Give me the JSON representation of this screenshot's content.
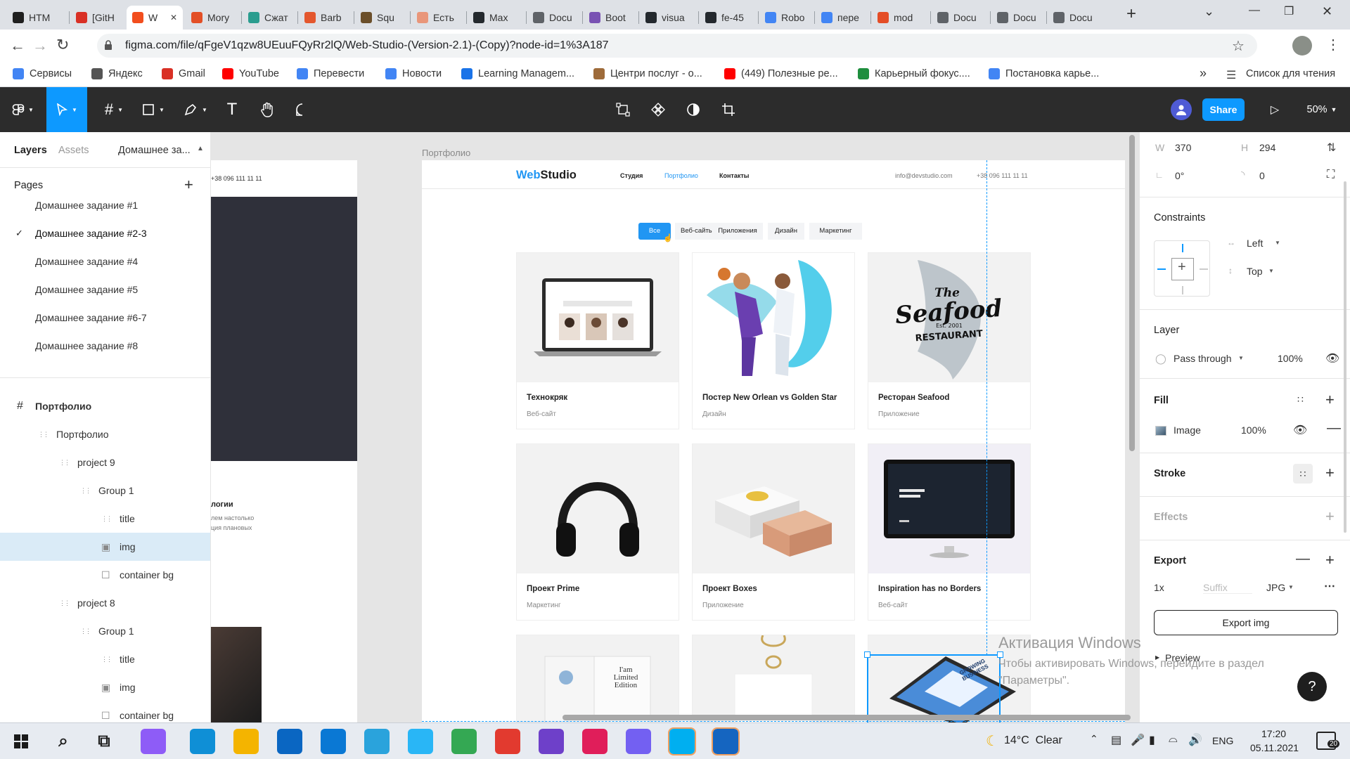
{
  "browser": {
    "tabs": [
      {
        "label": "HTM",
        "color": "#1f1f1f"
      },
      {
        "label": "[GitH",
        "color": "#d93025"
      },
      {
        "label": "W",
        "color": "#f24e1e"
      },
      {
        "label": "Mory",
        "color": "#e34f26"
      },
      {
        "label": "Сжат",
        "color": "#2a9d8f"
      },
      {
        "label": "Barb",
        "color": "#e4572e"
      },
      {
        "label": "Squ",
        "color": "#6b4f2a"
      },
      {
        "label": "Есть",
        "color": "#e9967a"
      },
      {
        "label": "Max",
        "color": "#24292e"
      },
      {
        "label": "Docu",
        "color": "#5f6368"
      },
      {
        "label": "Boot",
        "color": "#7952b3"
      },
      {
        "label": "visua",
        "color": "#24292e"
      },
      {
        "label": "fe-45",
        "color": "#24292e"
      },
      {
        "label": "Robo",
        "color": "#4285f4"
      },
      {
        "label": "пере",
        "color": "#4285f4"
      },
      {
        "label": "mod",
        "color": "#e44d26"
      },
      {
        "label": "Docu",
        "color": "#5f6368"
      },
      {
        "label": "Docu",
        "color": "#5f6368"
      },
      {
        "label": "Docu",
        "color": "#5f6368"
      }
    ],
    "url": "figma.com/file/qFgeV1qzw8UEuuFQyRr2lQ/Web-Studio-(Version-2.1)-(Copy)?node-id=1%3A187",
    "bookmarks": [
      {
        "label": "Сервисы",
        "color": "#4285f4"
      },
      {
        "label": "Яндекс",
        "color": "#555555"
      },
      {
        "label": "Gmail",
        "color": "#d93025"
      },
      {
        "label": "YouTube",
        "color": "#ff0000"
      },
      {
        "label": "Перевести",
        "color": "#4285f4"
      },
      {
        "label": "Новости",
        "color": "#4285f4"
      },
      {
        "label": "Learning Managem...",
        "color": "#1a73e8"
      },
      {
        "label": "Центри послуг - о...",
        "color": "#9e6b3a"
      },
      {
        "label": "(449) Полезные ре...",
        "color": "#ff0000"
      },
      {
        "label": "Карьерный фокус....",
        "color": "#1e8e3e"
      },
      {
        "label": "Постановка карье...",
        "color": "#4285f4"
      }
    ],
    "reading_list": "Список для чтения",
    "more": "»"
  },
  "figma": {
    "share_label": "Share",
    "zoom": "50%",
    "left_panel": {
      "tab_layers": "Layers",
      "tab_assets": "Assets",
      "page_selector": "Домашнее за...",
      "pages_title": "Pages",
      "pages": [
        "Домашнее задание #1",
        "Домашнее задание #2-3",
        "Домашнее задание #4",
        "Домашнее задание #5",
        "Домашнее задание #6-7",
        "Домашнее задание #8"
      ],
      "current_page_index": 1,
      "layers": [
        {
          "label": "Портфолио",
          "indent": 0,
          "icon": "frame",
          "bold": true
        },
        {
          "label": "Портфолио",
          "indent": 1,
          "icon": "group"
        },
        {
          "label": "project 9",
          "indent": 2,
          "icon": "group"
        },
        {
          "label": "Group 1",
          "indent": 3,
          "icon": "group"
        },
        {
          "label": "title",
          "indent": 4,
          "icon": "group"
        },
        {
          "label": "img",
          "indent": 4,
          "icon": "image",
          "selected": true
        },
        {
          "label": "container bg",
          "indent": 4,
          "icon": "rect"
        },
        {
          "label": "project 8",
          "indent": 2,
          "icon": "group"
        },
        {
          "label": "Group 1",
          "indent": 3,
          "icon": "group"
        },
        {
          "label": "title",
          "indent": 4,
          "icon": "group"
        },
        {
          "label": "img",
          "indent": 4,
          "icon": "image"
        },
        {
          "label": "container bg",
          "indent": 4,
          "icon": "rect"
        }
      ]
    },
    "canvas": {
      "frame_label": "Портфолио",
      "side_phone": "+38 096 111 11 11",
      "side_text_title": "логии",
      "side_text_1": "лем настолько",
      "side_text_2": "ция плановых",
      "site": {
        "logo_a": "Web",
        "logo_b": "Studio",
        "nav": [
          "Студия",
          "Портфолио",
          "Контакты"
        ],
        "email": "info@devstudio.com",
        "phone": "+38 096 111 11 11",
        "filters": [
          "Все",
          "Веб-сайты",
          "Приложения",
          "Дизайн",
          "Маркетинг"
        ],
        "projects": [
          {
            "title": "Технокряк",
            "category": "Веб-сайт",
            "art": "laptop"
          },
          {
            "title": "Постер New Orlean vs Golden Star",
            "category": "Дизайн",
            "art": "poster"
          },
          {
            "title": "Ресторан Seafood",
            "category": "Приложение",
            "art": "seafood"
          },
          {
            "title": "Проект Prime",
            "category": "Маркетинг",
            "art": "headphones"
          },
          {
            "title": "Проект Boxes",
            "category": "Приложение",
            "art": "boxes"
          },
          {
            "title": "Inspiration has no Borders",
            "category": "Веб-сайт",
            "art": "monitor"
          }
        ],
        "seafood_logo": {
          "the": "The",
          "main": "Seafood",
          "est": "Est. 2001",
          "sub": "RESTAURANT"
        },
        "book_text": "I'am Limited Edition",
        "growing_text": "GROWING BUSINESS"
      }
    },
    "right_panel": {
      "w_label": "W",
      "w_value": "370",
      "h_label": "H",
      "h_value": "294",
      "rotation": "0°",
      "radius": "0",
      "constraints_title": "Constraints",
      "constraint_h": "Left",
      "constraint_v": "Top",
      "layer_title": "Layer",
      "blend": "Pass through",
      "layer_opacity": "100%",
      "fill_title": "Fill",
      "fill_type": "Image",
      "fill_opacity": "100%",
      "stroke_title": "Stroke",
      "effects_title": "Effects",
      "export_title": "Export",
      "export_scale": "1x",
      "export_suffix": "Suffix",
      "export_format": "JPG",
      "export_button": "Export img",
      "preview_label": "Preview"
    },
    "watermark": {
      "title": "Активация Windows",
      "line1": "Чтобы активировать Windows, перейдите в раздел",
      "line2": "\"Параметры\"."
    }
  },
  "taskbar": {
    "weather": "14°C  Clear",
    "lang": "ENG",
    "time": "17:20",
    "date": "05.11.2021",
    "notifications": "20",
    "apps": [
      {
        "name": "search-icon",
        "color": "#1f1f1f"
      },
      {
        "name": "task-view-icon",
        "color": "#1f1f1f"
      },
      {
        "name": "app-purple-icon",
        "color": "#8e5cf7"
      },
      {
        "name": "edge-icon",
        "color": "#0f8fd6"
      },
      {
        "name": "file-explorer-icon",
        "color": "#f4b400"
      },
      {
        "name": "mail-icon",
        "color": "#0a66c2"
      },
      {
        "name": "vscode-icon",
        "color": "#0a78d4"
      },
      {
        "name": "telegram-icon",
        "color": "#2aa3dc"
      },
      {
        "name": "yandex-browser-icon",
        "color": "#29b6f6"
      },
      {
        "name": "chrome-icon",
        "color": "#34a853"
      },
      {
        "name": "yandex-icon",
        "color": "#e23a2f"
      },
      {
        "name": "github-icon",
        "color": "#6e40c9"
      },
      {
        "name": "slack-icon",
        "color": "#e01e5a"
      },
      {
        "name": "viber-icon",
        "color": "#7360f2"
      },
      {
        "name": "skype-icon",
        "color": "#00aff0"
      },
      {
        "name": "photos-icon",
        "color": "#1565c0"
      }
    ]
  }
}
